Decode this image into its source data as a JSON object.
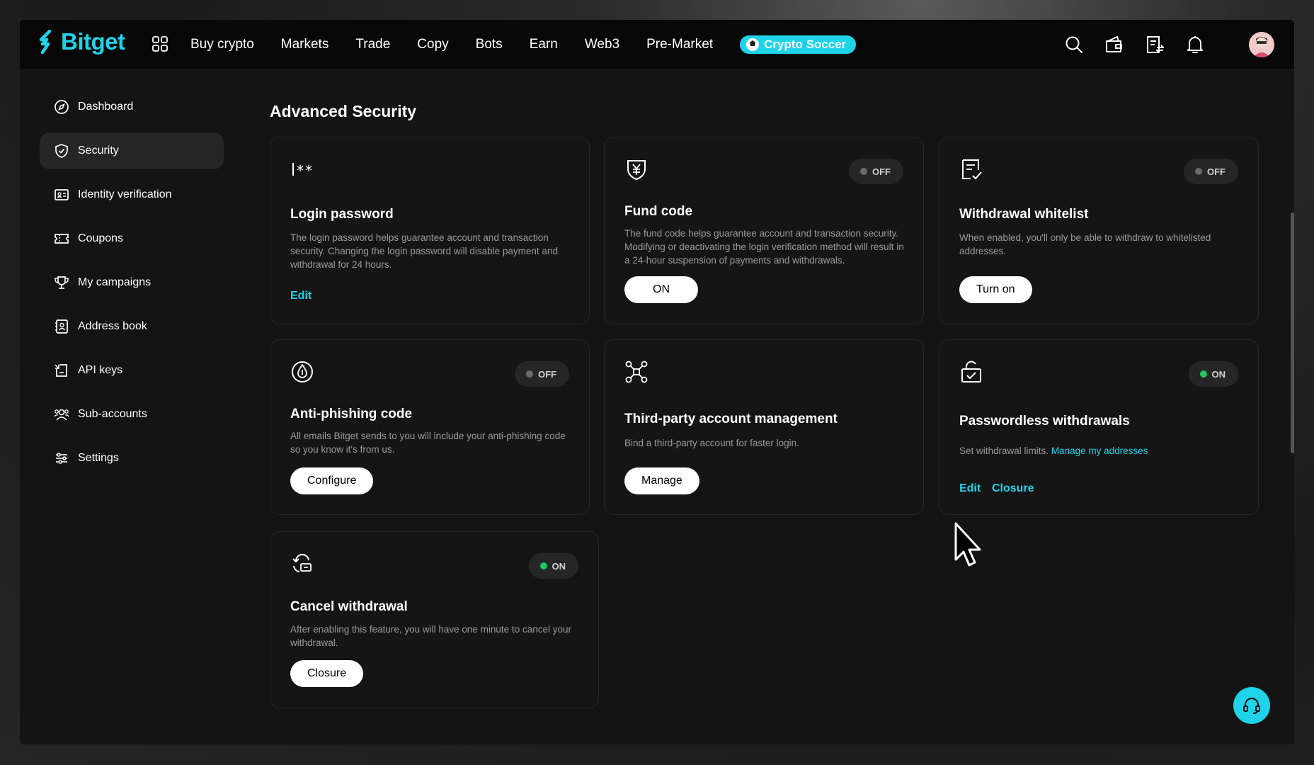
{
  "brand": {
    "name": "Bitget",
    "accent": "#1fd3e8"
  },
  "nav": {
    "items": [
      "Buy crypto",
      "Markets",
      "Trade",
      "Copy",
      "Bots",
      "Earn",
      "Web3",
      "Pre-Market"
    ],
    "promo": "Crypto Soccer"
  },
  "top_icons": [
    "search-icon",
    "wallet-icon",
    "orders-icon",
    "bell-icon",
    "avatar"
  ],
  "sidebar": {
    "items": [
      {
        "label": "Dashboard",
        "icon": "compass-icon"
      },
      {
        "label": "Security",
        "icon": "shield-icon",
        "active": true
      },
      {
        "label": "Identity verification",
        "icon": "id-card-icon"
      },
      {
        "label": "Coupons",
        "icon": "coupon-icon"
      },
      {
        "label": "My campaigns",
        "icon": "trophy-icon"
      },
      {
        "label": "Address book",
        "icon": "address-book-icon"
      },
      {
        "label": "API keys",
        "icon": "api-icon"
      },
      {
        "label": "Sub-accounts",
        "icon": "users-icon"
      },
      {
        "label": "Settings",
        "icon": "sliders-icon"
      }
    ]
  },
  "main": {
    "title": "Advanced Security",
    "cards": [
      {
        "id": "login-password",
        "icon": "password-icon",
        "title": "Login password",
        "desc": "The login password helps guarantee account and transaction security. Changing the login password will disable payment and withdrawal for 24 hours.",
        "actions": [
          "Edit"
        ]
      },
      {
        "id": "fund-code",
        "icon": "fund-shield-icon",
        "title": "Fund code",
        "status": "OFF",
        "desc": "The fund code helps guarantee account and transaction security. Modifying or deactivating the login verification method will result in a 24-hour suspension of payments and withdrawals.",
        "button": "ON"
      },
      {
        "id": "withdrawal-whitelist",
        "icon": "checklist-icon",
        "title": "Withdrawal whitelist",
        "status": "OFF",
        "desc": "When enabled, you'll only be able to withdraw to whitelisted addresses.",
        "button": "Turn on"
      },
      {
        "id": "anti-phishing",
        "icon": "anti-phishing-icon",
        "title": "Anti-phishing code",
        "status": "OFF",
        "desc": "All emails Bitget sends to you will include your anti-phishing code so you know it's from us.",
        "button": "Configure"
      },
      {
        "id": "third-party",
        "icon": "network-icon",
        "title": "Third-party account management",
        "desc": "Bind a third-party account for faster login.",
        "button": "Manage"
      },
      {
        "id": "passwordless",
        "icon": "unlocked-bag-icon",
        "title": "Passwordless withdrawals",
        "status": "ON",
        "desc": "Set withdrawal limits.",
        "desc_link": "Manage my addresses",
        "actions": [
          "Edit",
          "Closure"
        ]
      },
      {
        "id": "cancel-withdrawal",
        "icon": "cancel-withdrawal-icon",
        "title": "Cancel withdrawal",
        "status": "ON",
        "desc": "After enabling this feature, you will have one minute to cancel your withdrawal.",
        "button": "Closure"
      }
    ]
  },
  "support_icon": "headset-icon"
}
